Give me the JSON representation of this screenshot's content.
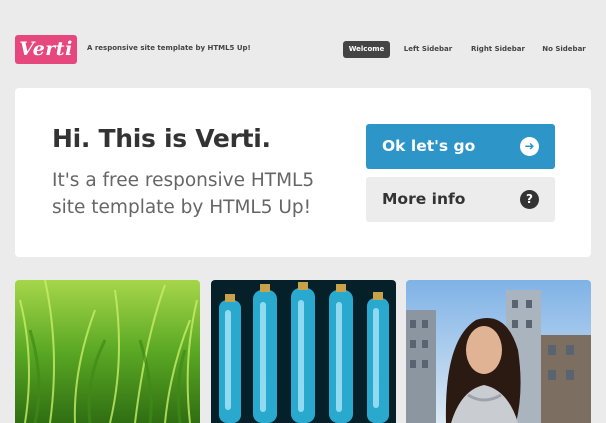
{
  "header": {
    "logo_text": "Verti",
    "tagline": "A responsive site template by HTML5 Up!"
  },
  "nav": {
    "items": [
      {
        "label": "Welcome",
        "active": true
      },
      {
        "label": "Left Sidebar",
        "active": false
      },
      {
        "label": "Right Sidebar",
        "active": false
      },
      {
        "label": "No Sidebar",
        "active": false
      }
    ]
  },
  "banner": {
    "title": "Hi. This is Verti.",
    "subtitle": "It's a free responsive HTML5 site template by HTML5 Up!",
    "primary_button": {
      "label": "Ok let's go",
      "icon": "arrow-right-circle-icon"
    },
    "secondary_button": {
      "label": "More info",
      "icon": "question-circle-icon"
    }
  },
  "colors": {
    "accent": "#2e95c9",
    "logo": "#e6487e",
    "page_background": "#ebebeb"
  },
  "tiles": [
    {
      "subject": "green grass"
    },
    {
      "subject": "blue glass bottles"
    },
    {
      "subject": "woman portrait with buildings"
    }
  ]
}
